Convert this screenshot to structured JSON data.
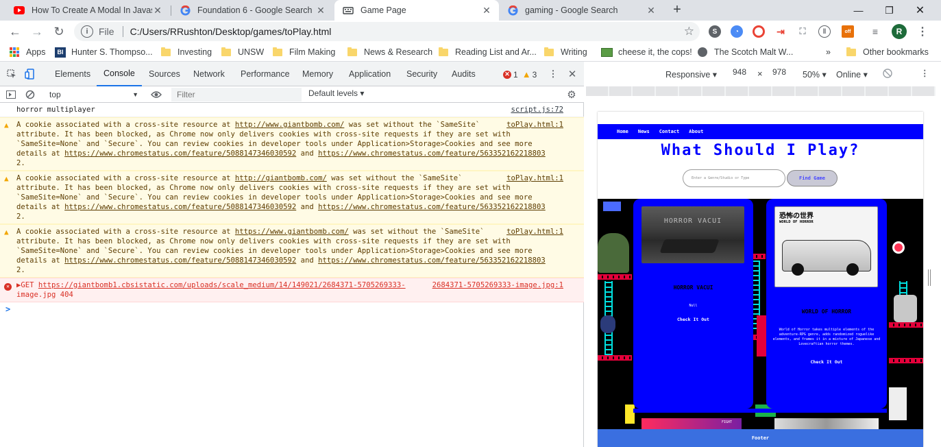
{
  "browser": {
    "tabs": [
      {
        "title": "How To Create A Modal In Javasc",
        "favicon": "youtube-icon"
      },
      {
        "title": "Foundation 6 - Google Search",
        "favicon": "google-icon"
      },
      {
        "title": "Game Page",
        "favicon": "keyboard-icon"
      },
      {
        "title": "gaming - Google Search",
        "favicon": "google-icon"
      }
    ],
    "active_tab": 2,
    "omnibox": {
      "scheme": "File",
      "url": "C:/Users/RRushton/Desktop/games/toPlay.html"
    },
    "profile_initial": "R",
    "bookmarks": [
      {
        "label": "Apps",
        "icon": "apps-icon"
      },
      {
        "label": "Hunter S. Thompso...",
        "icon": "bi-icon"
      },
      {
        "label": "Investing",
        "icon": "folder-icon"
      },
      {
        "label": "UNSW",
        "icon": "folder-icon"
      },
      {
        "label": "Film Making",
        "icon": "folder-icon"
      },
      {
        "label": "News & Research",
        "icon": "folder-icon"
      },
      {
        "label": "Reading List and Ar...",
        "icon": "folder-icon"
      },
      {
        "label": "Writing",
        "icon": "folder-icon"
      },
      {
        "label": "cheese it, the cops!",
        "icon": "image-icon"
      },
      {
        "label": "The Scotch Malt W...",
        "icon": "globe-icon"
      }
    ],
    "more_bookmarks": "»",
    "other_bookmarks": "Other bookmarks"
  },
  "devtools": {
    "tabs": [
      "Elements",
      "Console",
      "Sources",
      "Network",
      "Performance",
      "Memory",
      "Application",
      "Security",
      "Audits"
    ],
    "active_tab": "Console",
    "error_count": "1",
    "warning_count": "3",
    "console_context": "top",
    "filter_placeholder": "Filter",
    "levels_label": "Default levels",
    "messages": [
      {
        "level": "log",
        "lines": [
          "horror multiplayer"
        ],
        "source": "script.js:72"
      },
      {
        "level": "warning",
        "lines": [
          "A cookie associated with a cross-site resource at http://www.giantbomb.com/ was set without the `SameSite`",
          "attribute. It has been blocked, as Chrome now only delivers cookies with cross-site requests if they are set with",
          "`SameSite=None` and `Secure`. You can review cookies in developer tools under Application>Storage>Cookies and see more",
          "details at https://www.chromestatus.com/feature/5088147346030592 and https://www.chromestatus.com/feature/563352162218803",
          "2."
        ],
        "source": "toPlay.html:1"
      },
      {
        "level": "warning",
        "lines": [
          "A cookie associated with a cross-site resource at http://giantbomb.com/ was set without the `SameSite`",
          "attribute. It has been blocked, as Chrome now only delivers cookies with cross-site requests if they are set with",
          "`SameSite=None` and `Secure`. You can review cookies in developer tools under Application>Storage>Cookies and see more",
          "details at https://www.chromestatus.com/feature/5088147346030592 and https://www.chromestatus.com/feature/563352162218803",
          "2."
        ],
        "source": "toPlay.html:1"
      },
      {
        "level": "warning",
        "lines": [
          "A cookie associated with a cross-site resource at https://www.giantbomb.com/ was set without the `SameSite`",
          "attribute. It has been blocked, as Chrome now only delivers cookies with cross-site requests if they are set with",
          "`SameSite=None` and `Secure`. You can review cookies in developer tools under Application>Storage>Cookies and see more",
          "details at https://www.chromestatus.com/feature/5088147346030592 and https://www.chromestatus.com/feature/563352162218803",
          "2."
        ],
        "source": "toPlay.html:1"
      },
      {
        "level": "error",
        "lines": [
          "▶GET https://giantbomb1.cbsistatic.com/uploads/scale_medium/14/149021/2684371-5705269333-",
          "image.jpg 404"
        ],
        "source": "2684371-5705269333-image.jpg:1"
      }
    ],
    "prompt_symbol": ">"
  },
  "device_toolbar": {
    "mode": "Responsive",
    "width": "948",
    "height": "978",
    "times": "×",
    "zoom": "50%",
    "network": "Online"
  },
  "site": {
    "nav": [
      "Home",
      "News",
      "Contact",
      "About"
    ],
    "title": "What Should I Play?",
    "search_placeholder": "Enter a Genre/Studio or Type",
    "find_button": "Find Game",
    "cards": [
      {
        "image_caption": "HORROR VACUI",
        "title": "HORROR VACUI",
        "text": "Null",
        "link": "Check It Out"
      },
      {
        "image_caption": "WORLD OF HORROR",
        "title": "WORLD OF HORROR",
        "text": "World of Horror takes multiple elements of the adventure-RPG genre, adds randomized roguelike elements, and frames it in a mixture of Japanese and Lovecraftian horror themes.",
        "link": "Check It Out"
      }
    ],
    "card_peek_label": "FIGHT",
    "footer": "Footer"
  },
  "colors": {
    "site_blue": "#0000ff",
    "warning_bg": "#fffbe5",
    "error_bg": "#fff0f0",
    "devtools_accent": "#1a73e8"
  }
}
